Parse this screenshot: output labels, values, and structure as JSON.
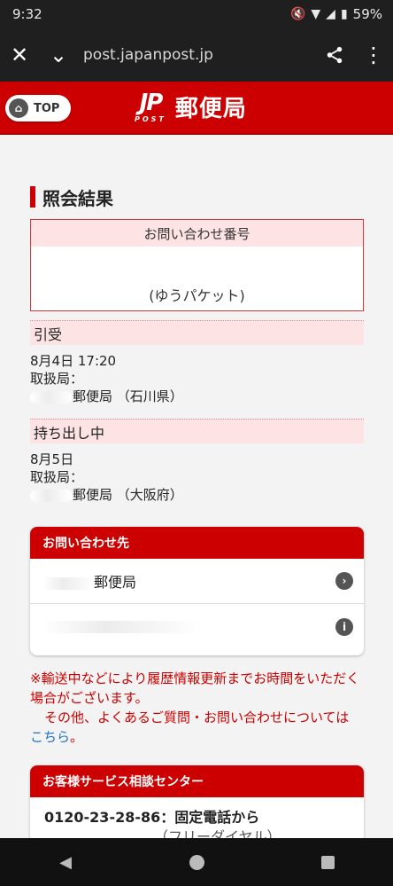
{
  "status_bar": {
    "time": "9:32",
    "battery": "59%"
  },
  "browser": {
    "url": "post.japanpost.jp"
  },
  "header": {
    "top_label": "TOP",
    "logo_mark": "JP",
    "logo_post": "POST",
    "logo_name": "郵便局"
  },
  "page": {
    "title": "照会結果"
  },
  "tracking": {
    "head": "お問い合わせ番号",
    "number": "",
    "type": "(ゆうパケット)"
  },
  "events": [
    {
      "status": "引受",
      "date": "8月4日 17:20",
      "office_label": "取扱局：",
      "office": "郵便局 （石川県）"
    },
    {
      "status": "持ち出し中",
      "date": "8月5日",
      "office_label": "取扱局：",
      "office": "郵便局 （大阪府）"
    }
  ],
  "contact": {
    "head": "お問い合わせ先",
    "office": "郵便局"
  },
  "notice": {
    "line1": "※輸送中などにより履歴情報更新までお時間をいただく場合がございます。",
    "line2": "その他、よくあるご質問・お問い合わせについては",
    "link": "こちら",
    "end": "。"
  },
  "service_center": {
    "head": "お客様サービス相談センター",
    "phone": "0120-23-28-86：固定電話から",
    "sub": "（フリーダイヤル）"
  }
}
